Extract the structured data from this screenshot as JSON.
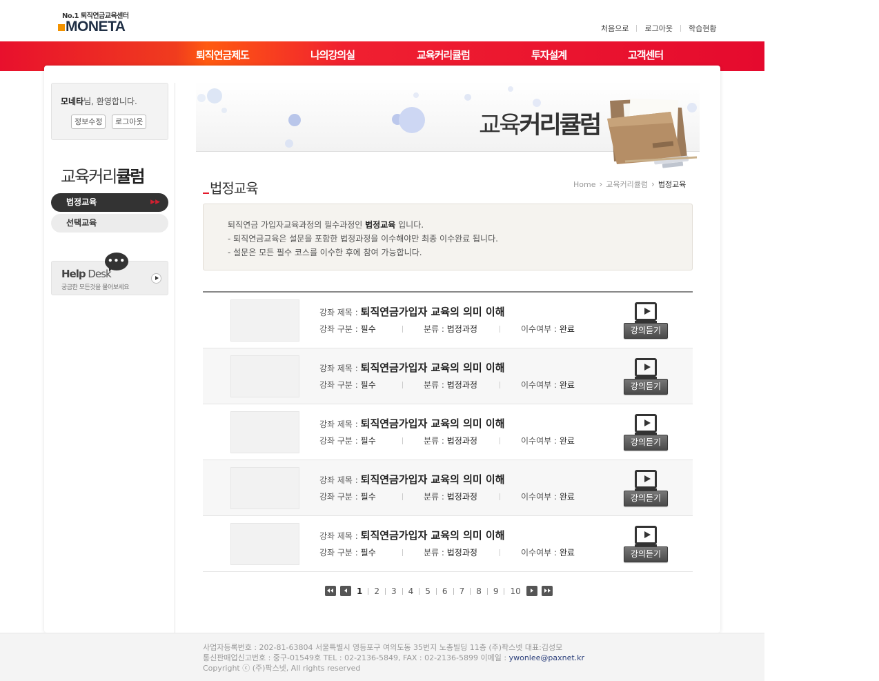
{
  "logo": {
    "tagline_no": "No.1",
    "tagline_text": "퇴직연금교육센터",
    "name": "MONETA"
  },
  "topnav": [
    "처음으로",
    "로그아웃",
    "학습현황"
  ],
  "gnb": [
    "퇴직연금제도",
    "나의강의실",
    "교육커리큘럼",
    "투자설계",
    "고객센터"
  ],
  "login": {
    "user": "모네타",
    "greeting": "님, 환영합니다.",
    "edit_btn": "정보수정",
    "logout_btn": "로그아웃"
  },
  "lnb": {
    "title_a": "교육",
    "title_b": "커리",
    "title_c": "큘럼",
    "items": [
      {
        "label": "법정교육",
        "active": true
      },
      {
        "label": "선택교육",
        "active": false
      }
    ]
  },
  "helpdesk": {
    "title_a": "Help",
    "title_b": " Desk",
    "sub": "궁금한 모든것을 물어보세요",
    "bubble": "•••"
  },
  "visual": {
    "title_a": "교육",
    "title_b": "커리큘럼"
  },
  "page": {
    "title": "법정교육"
  },
  "breadcrumb": [
    "Home",
    "교육커리큘럼",
    "법정교육"
  ],
  "notice": {
    "l1_a": "퇴직연금 가입자교육과정의 필수과정인 ",
    "l1_b": "법정교육",
    "l1_c": " 입니다.",
    "l2": "- 퇴직연금교육은 설문을 포함한 법정과정을 이수해야만 최종 이수완료 됩니다.",
    "l3": "- 설문은 모든 필수 코스를 이수한 후에 참여 가능합니다."
  },
  "labels": {
    "title": "강좌 제목 : ",
    "type": "강좌 구분 : ",
    "category": "분류 : ",
    "status": "이수여부 : ",
    "listen": "강의듣기"
  },
  "courses": [
    {
      "title": "퇴직연금가입자 교육의 의미 이해",
      "type": "필수",
      "category": "법정과정",
      "status": "완료"
    },
    {
      "title": "퇴직연금가입자 교육의 의미 이해",
      "type": "필수",
      "category": "법정과정",
      "status": "완료"
    },
    {
      "title": "퇴직연금가입자 교육의 의미 이해",
      "type": "필수",
      "category": "법정과정",
      "status": "완료"
    },
    {
      "title": "퇴직연금가입자 교육의 의미 이해",
      "type": "필수",
      "category": "법정과정",
      "status": "완료"
    },
    {
      "title": "퇴직연금가입자 교육의 의미 이해",
      "type": "필수",
      "category": "법정과정",
      "status": "완료"
    }
  ],
  "pager": {
    "pages": [
      "1",
      "2",
      "3",
      "4",
      "5",
      "6",
      "7",
      "8",
      "9",
      "10"
    ],
    "current": "1"
  },
  "footer": {
    "line1": "사업자등록번호 : 202-81-63804 서울특별시 영등포구 여의도동 35번지 노총빌딩 11층 (주)팍스넷 대표:김성모",
    "line2_a": "통신판매업신고번호 : 중구-01549호 TEL : 02-2136-5849, FAX : 02-2136-5899 이메일 : ",
    "line2_mail": "ywonlee@paxnet.kr",
    "line3": "Copyright ⓒ (주)팍스넷, All rights reserved"
  },
  "colors": {
    "brand_red": "#e50a2e",
    "accent_orange": "#f29200",
    "dark": "#333333"
  }
}
